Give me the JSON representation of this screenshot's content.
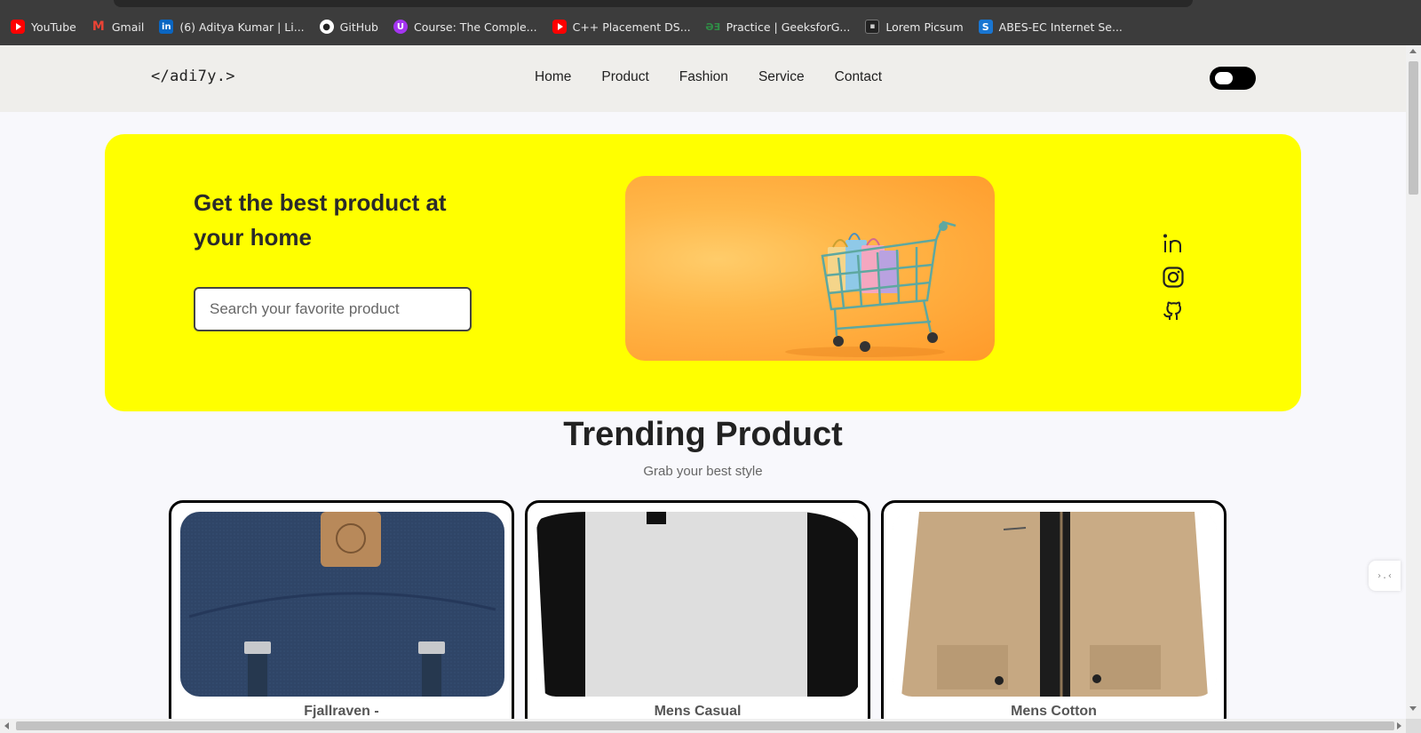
{
  "bookmarks": [
    {
      "label": "YouTube",
      "icon": "youtube-icon"
    },
    {
      "label": "Gmail",
      "icon": "gmail-icon"
    },
    {
      "label": "(6) Aditya Kumar | Li...",
      "icon": "linkedin-icon"
    },
    {
      "label": "GitHub",
      "icon": "github-icon"
    },
    {
      "label": "Course: The Comple...",
      "icon": "udemy-icon"
    },
    {
      "label": "C++ Placement DS...",
      "icon": "youtube-icon"
    },
    {
      "label": "Practice | GeeksforG...",
      "icon": "geeksforgeeks-icon"
    },
    {
      "label": "Lorem Picsum",
      "icon": "picsum-icon"
    },
    {
      "label": "ABES-EC Internet Se...",
      "icon": "abes-icon"
    }
  ],
  "header": {
    "logo": "</adi7y.>",
    "nav": [
      "Home",
      "Product",
      "Fashion",
      "Service",
      "Contact"
    ]
  },
  "hero": {
    "title": "Get the best product at your home",
    "search_placeholder": "Search your favorite product",
    "image": "shopping-cart-image",
    "accent": "#ffff00"
  },
  "socials": [
    "linkedin-icon",
    "instagram-icon",
    "github-icon"
  ],
  "trending": {
    "title": "Trending Product",
    "subtitle": "Grab your best style",
    "products": [
      {
        "name": "Fjallraven -",
        "image": "backpack-image"
      },
      {
        "name": "Mens Casual",
        "image": "tshirt-image"
      },
      {
        "name": "Mens Cotton",
        "image": "jacket-image"
      }
    ]
  }
}
